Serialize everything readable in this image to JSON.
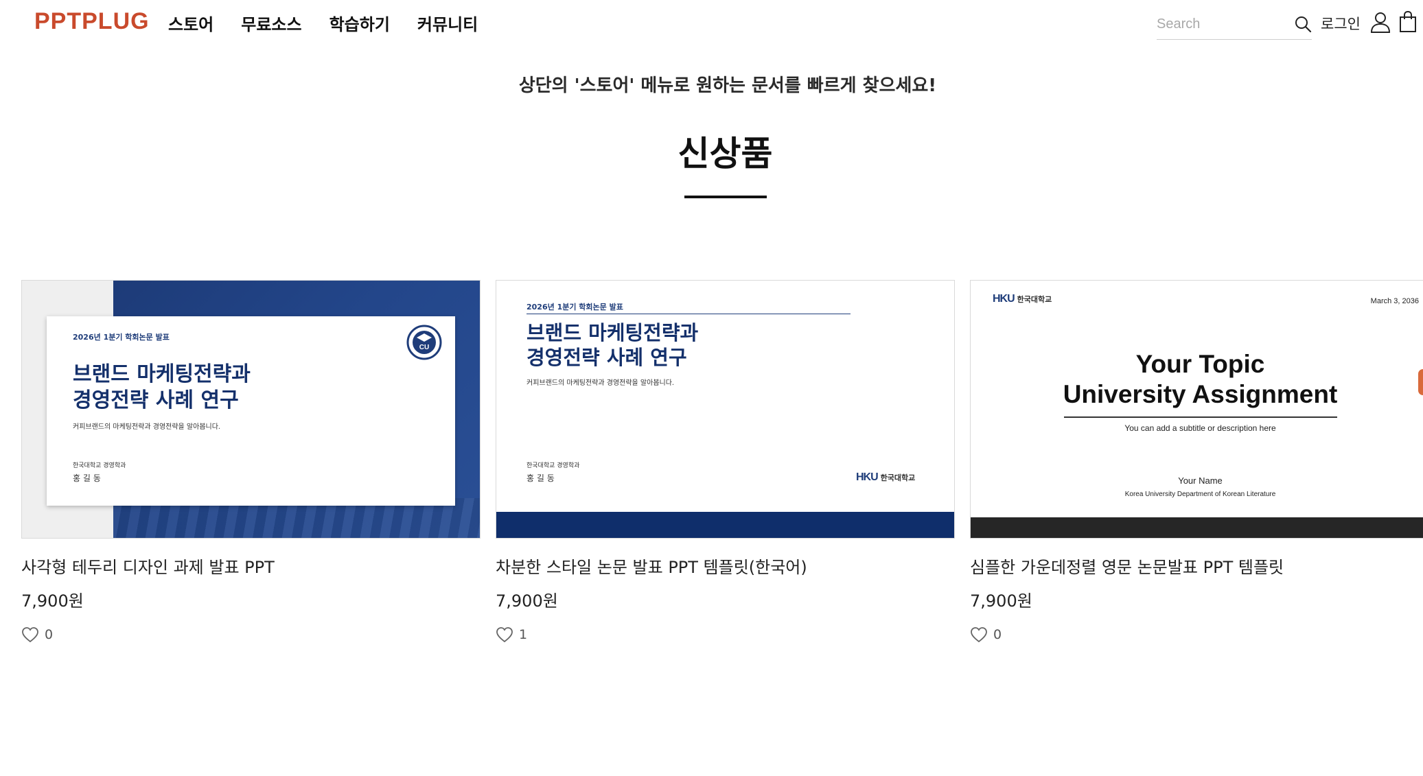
{
  "header": {
    "logo": "PPTPLUG",
    "nav": [
      "스토어",
      "무료소스",
      "학습하기",
      "커뮤니티"
    ],
    "search_placeholder": "Search",
    "search_value": "",
    "login_label": "로그인"
  },
  "notice": "상단의 '스토어' 메뉴로 원하는 문서를 빠르게 찾으세요!",
  "section_title": "신상품",
  "products": [
    {
      "name": "사각형 테두리 디자인 과제 발표 PPT",
      "price": "7,900원",
      "likes": "0",
      "thumb": {
        "label": "2026년 1분기 학회논문 발표",
        "title_line1": "브랜드 마케팅전략과",
        "title_line2": "경영전략 사례 연구",
        "desc": "커피브랜드의 마케팅전략과 경영전략을 알아봅니다.",
        "affiliation": "한국대학교 경영학과",
        "person": "홍 길 동",
        "emblem_text": "CU"
      }
    },
    {
      "name": "차분한 스타일 논문 발표 PPT 템플릿(한국어)",
      "price": "7,900원",
      "likes": "1",
      "thumb": {
        "label": "2026년 1분기 학회논문 발표",
        "title_line1": "브랜드 마케팅전략과",
        "title_line2": "경영전략 사례 연구",
        "desc": "커피브랜드의 마케팅전략과 경영전략을 알아봅니다.",
        "affiliation": "한국대학교 경영학과",
        "person": "홍 길 동",
        "logo_mark": "HKU",
        "logo_name": "한국대학교"
      }
    },
    {
      "name": "심플한 가운데정렬 영문 논문발표 PPT 템플릿",
      "price": "7,900원",
      "likes": "0",
      "thumb": {
        "logo_mark": "HKU",
        "logo_name": "한국대학교",
        "date": "March 3, 2036",
        "title_line1": "Your Topic",
        "title_line2": "University Assignment",
        "subtitle": "You can add a subtitle or description here",
        "name": "Your Name",
        "dept": "Korea University Department of Korean Literature"
      }
    }
  ],
  "colors": {
    "logo": "#c94a2c",
    "navy": "#1f3d7a",
    "navy_dark": "#0f2e6b"
  }
}
